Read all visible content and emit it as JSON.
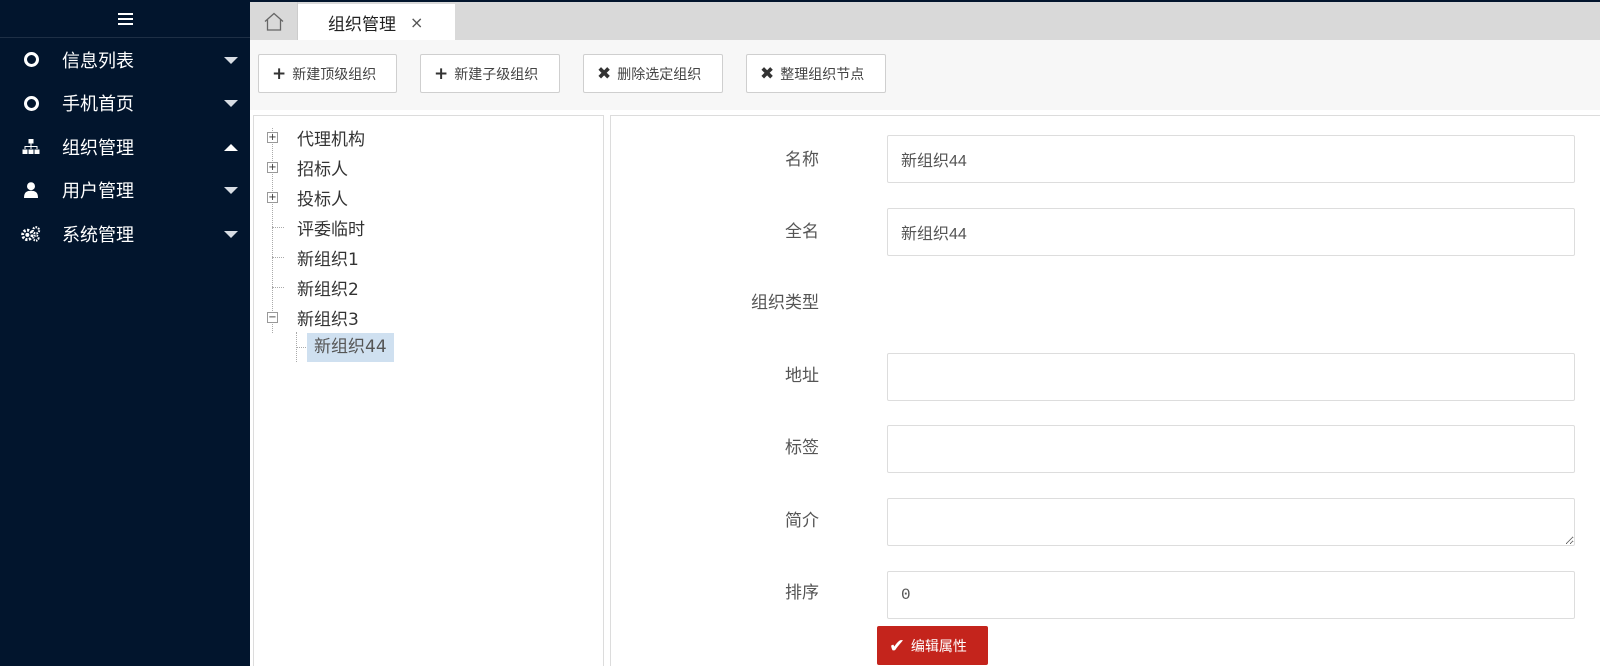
{
  "sidebar": {
    "items": [
      {
        "label": "信息列表",
        "icon": "circle-o-icon",
        "expanded": false
      },
      {
        "label": "手机首页",
        "icon": "circle-o-icon",
        "expanded": false
      },
      {
        "label": "组织管理",
        "icon": "sitemap-icon",
        "expanded": true
      },
      {
        "label": "用户管理",
        "icon": "user-icon",
        "expanded": false
      },
      {
        "label": "系统管理",
        "icon": "cogs-icon",
        "expanded": false
      }
    ]
  },
  "tabs": {
    "home_icon": "home-icon",
    "active": {
      "label": "组织管理",
      "close": "×"
    }
  },
  "toolbar": {
    "new_top": "新建顶级组织",
    "new_child": "新建子级组织",
    "delete_selected": "删除选定组织",
    "arrange_nodes": "整理组织节点",
    "plus": "+",
    "cross": "✖"
  },
  "tree": {
    "nodes": [
      {
        "label": "代理机构",
        "toggle": "+"
      },
      {
        "label": "招标人",
        "toggle": "+"
      },
      {
        "label": "投标人",
        "toggle": "+"
      },
      {
        "label": "评委临时"
      },
      {
        "label": "新组织1"
      },
      {
        "label": "新组织2"
      },
      {
        "label": "新组织3",
        "toggle": "−"
      },
      {
        "label": "新组织44",
        "selected": true
      }
    ]
  },
  "form": {
    "name": {
      "label": "名称",
      "value": "新组织44"
    },
    "fullname": {
      "label": "全名",
      "value": "新组织44"
    },
    "type": {
      "label": "组织类型"
    },
    "address": {
      "label": "地址",
      "value": ""
    },
    "tags": {
      "label": "标签",
      "value": ""
    },
    "intro": {
      "label": "简介",
      "value": ""
    },
    "order": {
      "label": "排序",
      "value": "0"
    },
    "save": {
      "label": "编辑属性",
      "icon": "✔"
    }
  },
  "colors": {
    "sidebar_bg": "#02152d",
    "save_button": "#c4241c",
    "selected_node": "#cfe0f0"
  }
}
